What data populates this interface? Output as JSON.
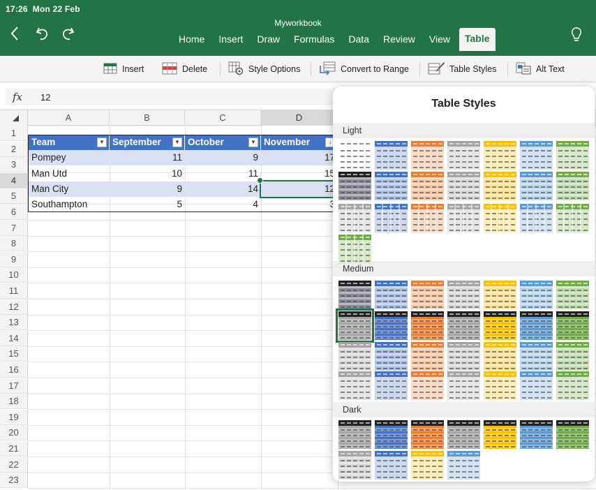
{
  "status": {
    "time": "17:26",
    "date": "Mon 22 Feb"
  },
  "doc_title": "Myworkbook",
  "tabs": [
    {
      "label": "Home",
      "active": false
    },
    {
      "label": "Insert",
      "active": false
    },
    {
      "label": "Draw",
      "active": false
    },
    {
      "label": "Formulas",
      "active": false
    },
    {
      "label": "Data",
      "active": false
    },
    {
      "label": "Review",
      "active": false
    },
    {
      "label": "View",
      "active": false
    },
    {
      "label": "Table",
      "active": true
    }
  ],
  "toolbar": {
    "insert": "Insert",
    "delete": "Delete",
    "style_options": "Style Options",
    "convert": "Convert to Range",
    "table_styles": "Table Styles",
    "alt_text": "Alt Text"
  },
  "formula_bar": {
    "fx": "fx",
    "value": "12"
  },
  "columns": [
    "A",
    "B",
    "C",
    "D"
  ],
  "rows": [
    "1",
    "2",
    "3",
    "4",
    "5",
    "6",
    "7",
    "8",
    "9",
    "10",
    "11",
    "12",
    "13",
    "14",
    "15",
    "16",
    "17",
    "18",
    "19",
    "20",
    "21",
    "22",
    "23"
  ],
  "table": {
    "headers": [
      "Team",
      "September",
      "October",
      "November"
    ],
    "data": [
      [
        "Pompey",
        "11",
        "9",
        "17"
      ],
      [
        "Man Utd",
        "10",
        "11",
        "15"
      ],
      [
        "Man City",
        "9",
        "14",
        "12"
      ],
      [
        "Southampton",
        "5",
        "4",
        "3"
      ]
    ]
  },
  "table_styles": {
    "title": "Table Styles",
    "sections": [
      "Light",
      "Medium",
      "Dark"
    ],
    "colors": {
      "accent": "#227447",
      "blue": "#4472c4",
      "orange": "#ed7d31",
      "gray": "#a5a5a5",
      "gold": "#ffc000",
      "lightblue": "#5b9bd5",
      "green": "#70ad47"
    }
  }
}
